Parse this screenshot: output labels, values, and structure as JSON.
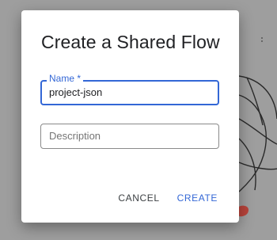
{
  "dialog": {
    "title": "Create a Shared Flow",
    "name_field": {
      "label": "Name *",
      "value": "project-json"
    },
    "description_field": {
      "placeholder": "Description",
      "value": ""
    },
    "actions": {
      "cancel_label": "CANCEL",
      "create_label": "CREATE"
    }
  },
  "colors": {
    "scrim": "#9e9e9e",
    "accent": "#3367d6",
    "background_badge": "#b8433a"
  },
  "icons": {
    "background": "decorative-line-art"
  }
}
